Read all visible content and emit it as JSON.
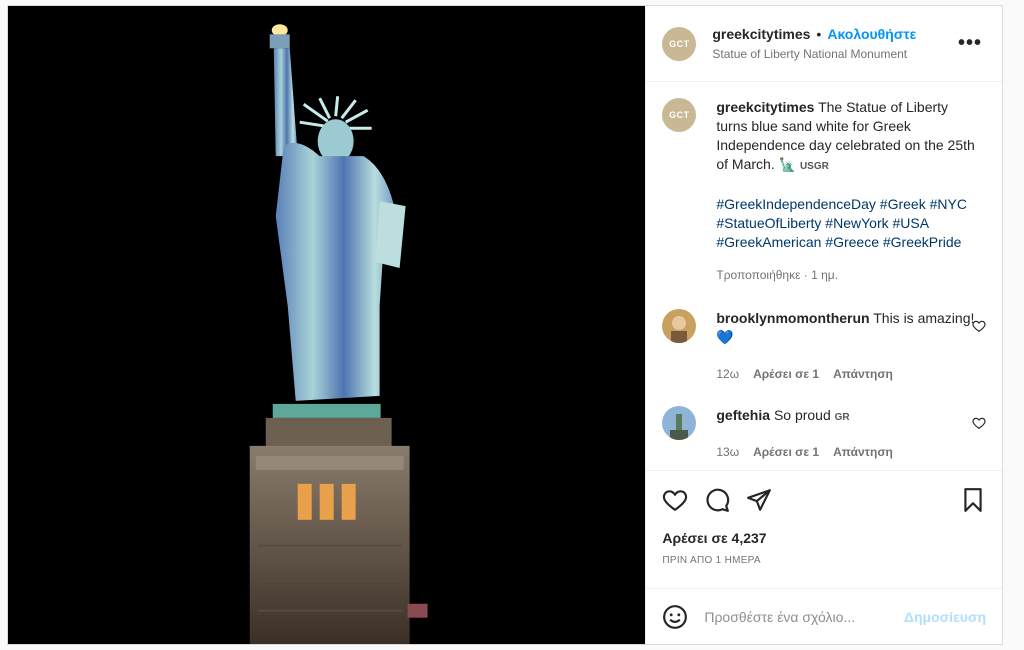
{
  "header": {
    "username": "greekcitytimes",
    "separator": "•",
    "follow_label": "Ακολουθήστε",
    "location": "Statue of Liberty National Monument",
    "more_label": "•••",
    "avatar_text": "GCT"
  },
  "caption": {
    "username": "greekcitytimes",
    "text": "The Statue of Liberty turns blue sand white for Greek Independence day celebrated on the 25th of March. 🗽",
    "flag": "USGR",
    "hashtags": "#GreekIndependenceDay #Greek #NYC #StatueOfLiberty #NewYork #USA #GreekAmerican #Greece #GreekPride",
    "edited": "Τροποποιήθηκε · 1 ημ."
  },
  "comments": [
    {
      "username": "brooklynmomontherun",
      "text": "This is amazing! 💙",
      "age": "12ω",
      "likes": "Αρέσει σε 1",
      "reply": "Απάντηση"
    },
    {
      "username": "geftehia",
      "text": "So proud",
      "flag": "GR",
      "age": "13ω",
      "likes": "Αρέσει σε 1",
      "reply": "Απάντηση"
    }
  ],
  "likes": "Αρέσει σε 4,237",
  "timestamp": "ΠΡΙΝ ΑΠΟ 1 ΗΜΕΡΑ",
  "add_comment": {
    "placeholder": "Προσθέστε ένα σχόλιο...",
    "publish_label": "Δημοσίευση"
  },
  "icons": {
    "like": "heart-icon",
    "comment": "comment-icon",
    "share": "share-icon",
    "save": "bookmark-icon",
    "emoji": "emoji-icon"
  },
  "colors": {
    "accent": "#0095f6",
    "hashtag": "#00376b",
    "muted": "#737373",
    "publish_disabled": "#b2dffc"
  }
}
